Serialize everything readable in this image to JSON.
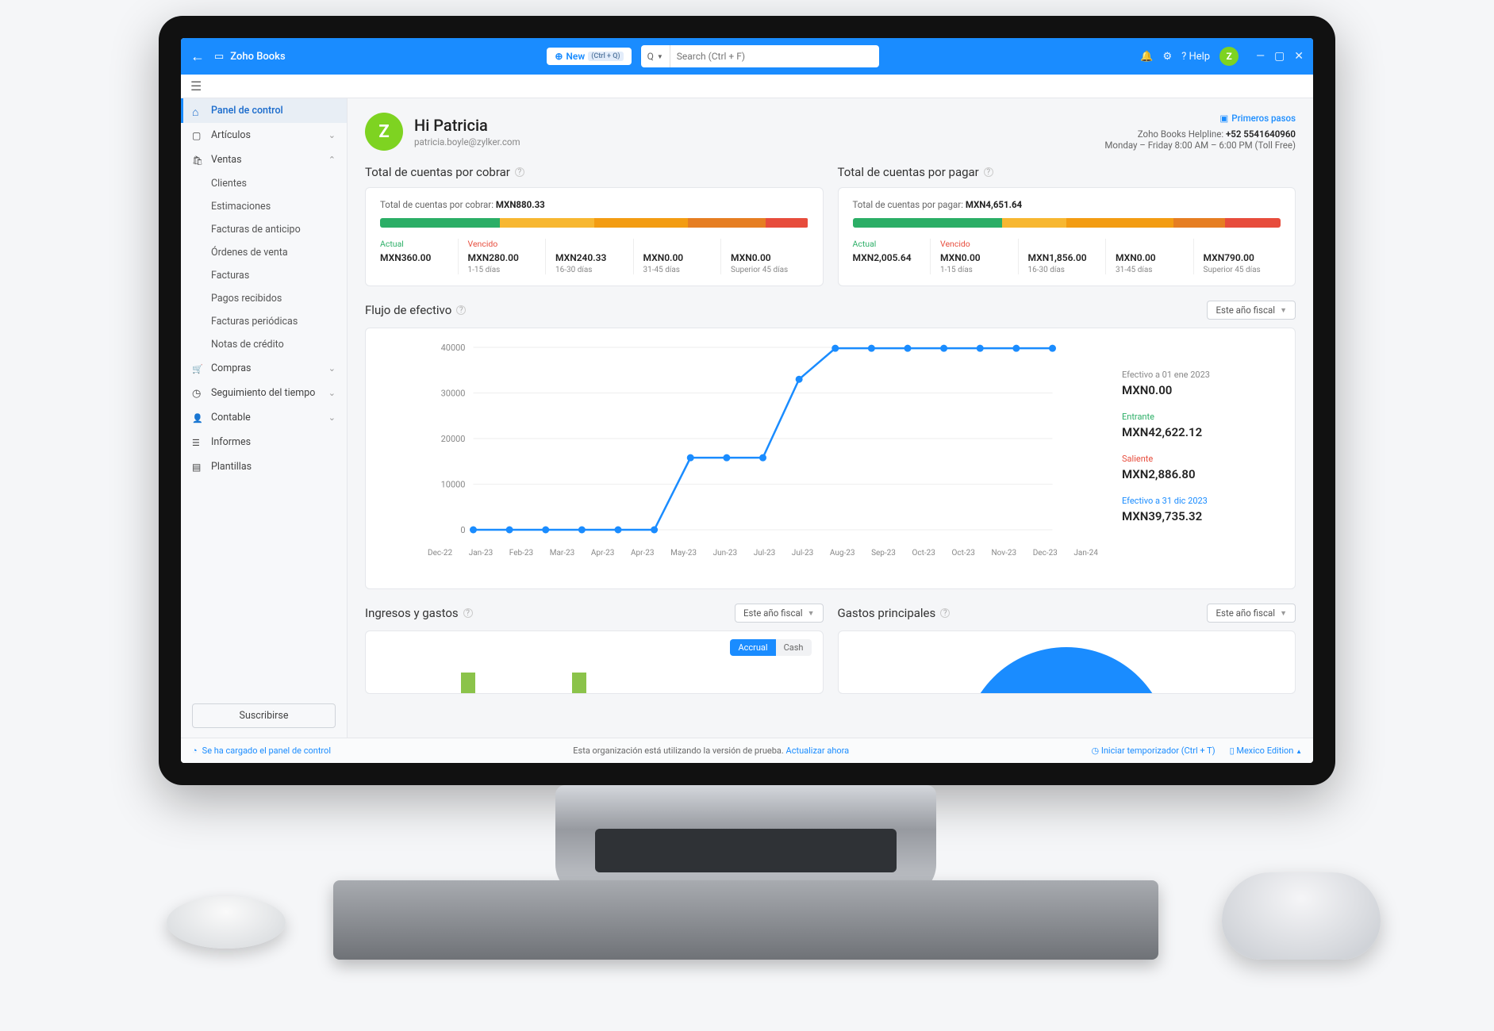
{
  "header": {
    "brand": "Zoho Books",
    "new_label": "New",
    "new_shortcut": "(Ctrl + Q)",
    "search_scope": "Q",
    "search_placeholder": "Search (Ctrl + F)",
    "help_label": "? Help",
    "avatar_letter": "Z"
  },
  "sidebar": {
    "items": [
      {
        "label": "Panel de control"
      },
      {
        "label": "Artículos"
      },
      {
        "label": "Ventas"
      },
      {
        "label": "Compras"
      },
      {
        "label": "Seguimiento del tiempo"
      },
      {
        "label": "Contable"
      },
      {
        "label": "Informes"
      },
      {
        "label": "Plantillas"
      }
    ],
    "ventas_sub": [
      "Clientes",
      "Estimaciones",
      "Facturas de anticipo",
      "Órdenes de venta",
      "Facturas",
      "Pagos recibidos",
      "Facturas periódicas",
      "Notas de crédito"
    ],
    "subscribe_label": "Suscribirse"
  },
  "greeting": {
    "title": "Hi Patricia",
    "email": "patricia.boyle@zylker.com",
    "avatar_letter": "Z"
  },
  "helpline": {
    "first_steps": "Primeros pasos",
    "label": "Zoho Books Helpline:",
    "number": "+52 5541640960",
    "hours": "Monday – Friday 8:00 AM – 6:00 PM (Toll Free)"
  },
  "receivables": {
    "title": "Total de cuentas por cobrar",
    "total_label": "Total de cuentas por cobrar:",
    "total_value": "MXN880.33",
    "bar_segments": [
      {
        "color": "#2bae66",
        "pct": 28
      },
      {
        "color": "#f7b731",
        "pct": 22
      },
      {
        "color": "#f39c12",
        "pct": 22
      },
      {
        "color": "#e67e22",
        "pct": 18
      },
      {
        "color": "#e74c3c",
        "pct": 10
      }
    ],
    "aging": [
      {
        "label": "Actual",
        "class": "green",
        "amount": "MXN360.00",
        "range": ""
      },
      {
        "label": "Vencido",
        "class": "red",
        "amount": "MXN280.00",
        "range": "1-15 días"
      },
      {
        "label": "",
        "class": "",
        "amount": "MXN240.33",
        "range": "16-30 días"
      },
      {
        "label": "",
        "class": "",
        "amount": "MXN0.00",
        "range": "31-45 días"
      },
      {
        "label": "",
        "class": "",
        "amount": "MXN0.00",
        "range": "Superior 45 días"
      }
    ]
  },
  "payables": {
    "title": "Total de cuentas por pagar",
    "total_label": "Total de cuentas por pagar:",
    "total_value": "MXN4,651.64",
    "bar_segments": [
      {
        "color": "#2bae66",
        "pct": 35
      },
      {
        "color": "#f7b731",
        "pct": 15
      },
      {
        "color": "#f39c12",
        "pct": 25
      },
      {
        "color": "#e67e22",
        "pct": 12
      },
      {
        "color": "#e74c3c",
        "pct": 13
      }
    ],
    "aging": [
      {
        "label": "Actual",
        "class": "green",
        "amount": "MXN2,005.64",
        "range": ""
      },
      {
        "label": "Vencido",
        "class": "red",
        "amount": "MXN0.00",
        "range": "1-15 días"
      },
      {
        "label": "",
        "class": "",
        "amount": "MXN1,856.00",
        "range": "16-30 días"
      },
      {
        "label": "",
        "class": "",
        "amount": "MXN0.00",
        "range": "31-45 días"
      },
      {
        "label": "",
        "class": "",
        "amount": "MXN790.00",
        "range": "Superior 45 días"
      }
    ]
  },
  "cashflow": {
    "title": "Flujo de efectivo",
    "dropdown": "Este año fiscal",
    "stats": {
      "start_label": "Efectivo a  01 ene 2023",
      "start_val": "MXN0.00",
      "in_label": "Entrante",
      "in_val": "MXN42,622.12",
      "out_label": "Saliente",
      "out_val": "MXN2,886.80",
      "end_label": "Efectivo a  31 dic 2023",
      "end_val": "MXN39,735.32"
    }
  },
  "income_expense": {
    "title": "Ingresos y gastos",
    "dropdown": "Este año fiscal",
    "toggle_a": "Accrual",
    "toggle_b": "Cash"
  },
  "top_expenses": {
    "title": "Gastos principales",
    "dropdown": "Este año fiscal"
  },
  "footer": {
    "status": "Se ha cargado el panel de control",
    "trial_text": "Esta organización está utilizando la versión de prueba.",
    "upgrade_link": "Actualizar ahora",
    "timer": "Iniciar temporizador (Ctrl + T)",
    "edition": "Mexico Edition"
  },
  "chart_data": {
    "type": "line",
    "title": "Flujo de efectivo",
    "ylabel": "",
    "xlabel": "",
    "ylim": [
      0,
      40000
    ],
    "y_ticks": [
      0,
      10000,
      20000,
      30000,
      40000
    ],
    "categories": [
      "Dec-22",
      "Jan-23",
      "Feb-23",
      "Mar-23",
      "Apr-23",
      "Apr-23",
      "May-23",
      "Jun-23",
      "Jul-23",
      "Jul-23",
      "Aug-23",
      "Sep-23",
      "Oct-23",
      "Oct-23",
      "Nov-23",
      "Dec-23",
      "Jan-24"
    ],
    "values": [
      0,
      0,
      0,
      0,
      0,
      0,
      15800,
      15800,
      15800,
      33000,
      39800,
      39800,
      39800,
      39800,
      39800,
      39800,
      39800
    ]
  }
}
